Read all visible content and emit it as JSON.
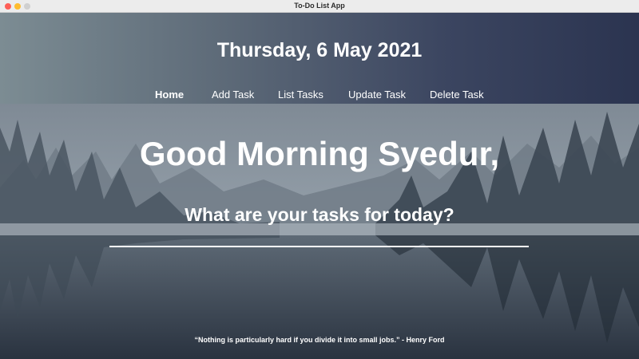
{
  "window": {
    "title": "To-Do List App"
  },
  "header": {
    "date": "Thursday, 6 May 2021"
  },
  "nav": {
    "home": "Home",
    "add": "Add Task",
    "list": "List Tasks",
    "update": "Update Task",
    "delete": "Delete Task"
  },
  "main": {
    "greeting": "Good Morning Syedur,",
    "prompt": "What are your tasks for today?",
    "task_input_value": ""
  },
  "footer": {
    "quote": "“Nothing is particularly hard if you divide it into small jobs.” - Henry Ford"
  },
  "colors": {
    "text": "#ffffff",
    "header_left": "#7c8c93",
    "header_right": "#2b3450"
  }
}
